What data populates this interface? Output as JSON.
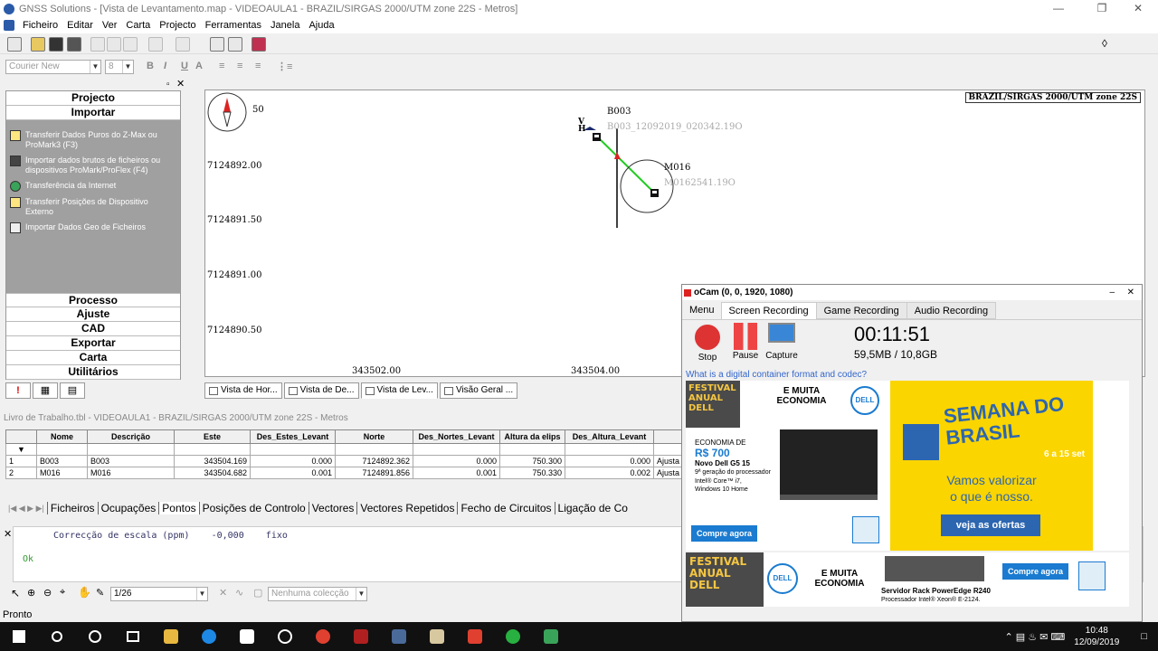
{
  "window": {
    "title": "GNSS Solutions - [Vista de Levantamento.map - VIDEOAULA1 - BRAZIL/SIRGAS 2000/UTM zone 22S - Metros]"
  },
  "menu": [
    "Ficheiro",
    "Editar",
    "Ver",
    "Carta",
    "Projecto",
    "Ferramentas",
    "Janela",
    "Ajuda"
  ],
  "format": {
    "font": "Courier New",
    "size": "8",
    "bold": "B",
    "italic": "I",
    "underline": "U"
  },
  "left_panel": {
    "top_sections": [
      "Projecto",
      "Importar"
    ],
    "items": [
      "Transferir Dados Puros do Z-Max ou ProMark3 (F3)",
      "Importar dados brutos de ficheiros ou dispositivos ProMark/ProFlex (F4)",
      "Transferência da Internet",
      "Transferir Posições de Dispositivo Externo",
      "Importar Dados Geo de Ficheiros"
    ],
    "bottom_sections": [
      "Processo",
      "Ajuste",
      "CAD",
      "Exportar",
      "Carta",
      "Utilitários"
    ],
    "tabs": [
      "!",
      "",
      ""
    ]
  },
  "map": {
    "crs": "BRAZIL/SIRGAS 2000/UTM zone 22S",
    "compass_label": "50",
    "y_ticks": [
      "7124892.00",
      "7124891.50",
      "7124891.00",
      "7124890.50"
    ],
    "x_ticks": [
      "343502.00",
      "343504.00"
    ],
    "points": [
      {
        "name": "B003",
        "file": "B003_12092019_020342.19O"
      },
      {
        "name": "M016",
        "file": "M0162541.19O"
      }
    ],
    "marker_letters": [
      "V",
      "H"
    ]
  },
  "view_tabs": [
    "Vista de Hor...",
    "Vista de De...",
    "Vista de Lev...",
    "Visão Geral ..."
  ],
  "workbook": {
    "title": "Livro de Trabalho.tbl - VIDEOAULA1 - BRAZIL/SIRGAS 2000/UTM zone 22S - Metros",
    "columns": [
      "Nome",
      "Descrição",
      "Este",
      "Des_Estes_Levant",
      "Norte",
      "Des_Nortes_Levant",
      "Altura da elips",
      "Des_Altura_Levant",
      ""
    ],
    "rows": [
      [
        "1",
        "B003",
        "B003",
        "343504.169",
        "0.000",
        "7124892.362",
        "0.000",
        "750.300",
        "0.000",
        "Ajusta"
      ],
      [
        "2",
        "M016",
        "M016",
        "343504.682",
        "0.001",
        "7124891.856",
        "0.001",
        "750.330",
        "0.002",
        "Ajusta"
      ]
    ],
    "tabs": [
      "Ficheiros",
      "Ocupações",
      "Pontos",
      "Posições de Controlo",
      "Vectores",
      "Vectores Repetidos",
      "Fecho de Circuitos",
      "Ligação de Co"
    ]
  },
  "console": {
    "line1": "Correcção de escala (ppm)    -0,000    fixo",
    "line2": "Ok"
  },
  "bottom_toolbar": {
    "page": "1/26",
    "collection": "Nenhuma colecção"
  },
  "status": "Pronto",
  "ocam": {
    "title": "oCam (0, 0, 1920, 1080)",
    "tabs": [
      "Menu",
      "Screen Recording",
      "Game Recording",
      "Audio Recording"
    ],
    "buttons": [
      "Stop",
      "Pause",
      "Capture"
    ],
    "timer": "00:11:51",
    "size": "59,5MB / 10,8GB",
    "ad_link": "What is a digital container format and codec?",
    "ad1": {
      "festival": "FESTIVAL ANUAL DELL",
      "tagline": "E MUITA ECONOMIA",
      "economy": "ECONOMIA DE",
      "price": "R$ 700",
      "product": "Novo Dell G5 15",
      "spec1": "9ª geração do processador",
      "spec2": "Intel® Core™ i7,",
      "spec3": "Windows 10 Home",
      "cta": "Compre agora",
      "brand": "DELL"
    },
    "ad_bb": {
      "headline": "SEMANA DO BRASIL",
      "dates": "6 a 15 set",
      "text1": "Vamos valorizar",
      "text2": "o que é nosso.",
      "cta": "veja as ofertas"
    },
    "ad2": {
      "festival": "FESTIVAL ANUAL DELL",
      "tagline": "E MUITA ECONOMIA",
      "product": "Servidor Rack PowerEdge R240",
      "spec": "Processador Intel® Xeon® E-2124.",
      "cta": "Compre agora",
      "brand": "DELL"
    }
  },
  "taskbar": {
    "time": "10:48",
    "date": "12/09/2019"
  }
}
